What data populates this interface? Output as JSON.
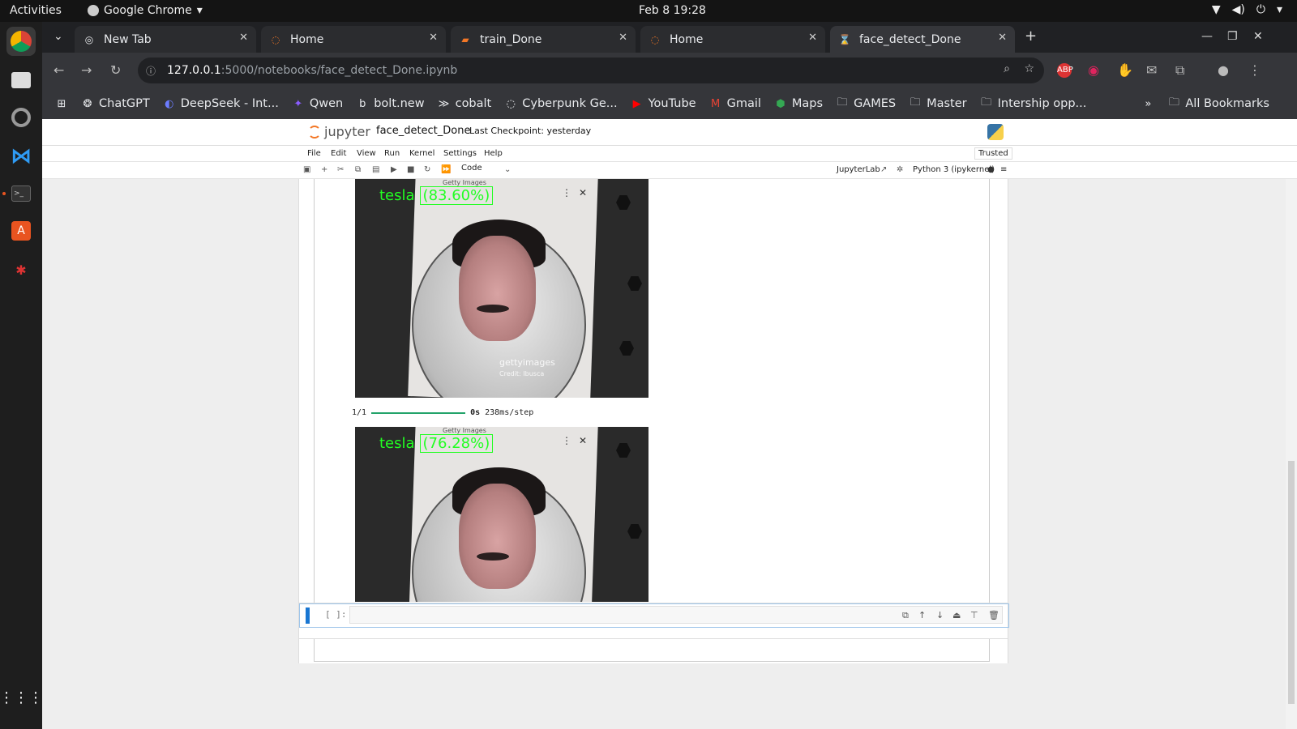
{
  "topbar": {
    "activities": "Activities",
    "app": "Google Chrome",
    "clock": "Feb 8  19:28"
  },
  "tabs": [
    {
      "label": "New Tab"
    },
    {
      "label": "Home"
    },
    {
      "label": "train_Done"
    },
    {
      "label": "Home"
    },
    {
      "label": "face_detect_Done"
    }
  ],
  "address": {
    "host": "127.0.0.1",
    "path": ":5000/notebooks/face_detect_Done.ipynb"
  },
  "bookmarks": [
    "ChatGPT",
    "DeepSeek - Int...",
    "Qwen",
    "bolt.new",
    "cobalt",
    "Cyberpunk Ge...",
    "YouTube",
    "Gmail",
    "Maps",
    "GAMES",
    "Master",
    "Intership opp..."
  ],
  "bookmarks_all": "All Bookmarks",
  "jupyter": {
    "logo": "jupyter",
    "notebook_name": "face_detect_Done",
    "checkpoint": "Last Checkpoint: yesterday",
    "trusted": "Trusted",
    "menu": [
      "File",
      "Edit",
      "View",
      "Run",
      "Kernel",
      "Settings",
      "Help"
    ],
    "cell_type": "Code",
    "jupyterlab": "JupyterLab",
    "kernel": "Python 3 (ipykernel)"
  },
  "outputs": {
    "img1": {
      "name": "tesla",
      "conf": "(83.60%)",
      "watermark": "gettyimages",
      "credit": "Credit: Ibusca",
      "source": "Getty Images"
    },
    "progress": {
      "step": "1/1",
      "time": "0s",
      "rate": "238ms/step"
    },
    "img2": {
      "name": "tesla",
      "conf": "(76.28%)",
      "source": "Getty Images"
    }
  },
  "cell": {
    "prompt": "[ ]:"
  },
  "colors": {
    "label_green": "#22ff22",
    "jupyter_orange": "#f37726",
    "progress_green": "#23a36a",
    "cell_blue": "#1976d2"
  }
}
